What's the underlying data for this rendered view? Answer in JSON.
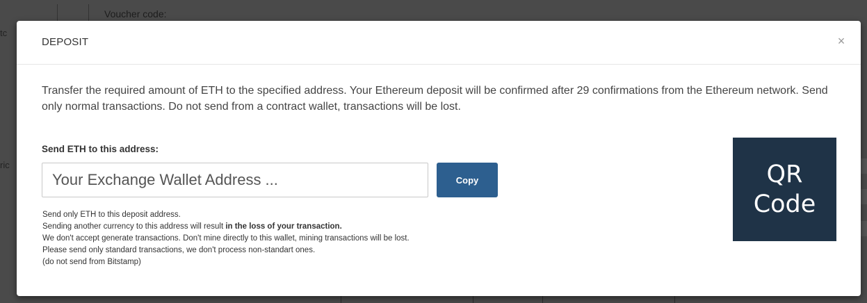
{
  "background": {
    "voucher_label": "Voucher code:",
    "edge_left_1": "tc",
    "edge_left_2": "ric"
  },
  "modal": {
    "title": "DEPOSIT",
    "close_glyph": "×",
    "intro": "Transfer the required amount of ETH to the specified address. Your Ethereum deposit will be confirmed after 29 confirmations from the Ethereum network. Send only normal transactions. Do not send from a contract wallet, transactions will be lost.",
    "address_label": "Send ETH to this address:",
    "address_value": "Your Exchange Wallet Address ...",
    "copy_label": "Copy",
    "notes": {
      "line1": "Send only ETH to this deposit address.",
      "line2_prefix": "Sending another currency to this address will result ",
      "line2_bold": "in the loss of your transaction.",
      "line3": "We don't accept generate transactions. Don't mine directly to this wallet, mining transactions will be lost.",
      "line4": "Please send only standard transactions, we don't process non-standart ones.",
      "line5": "(do not send from Bitstamp)"
    },
    "qr_line1": "QR",
    "qr_line2": "Code"
  },
  "colors": {
    "overlay": "#4a4a4a",
    "copy_button": "#2d5f8f",
    "qr_background": "#1f3347"
  }
}
